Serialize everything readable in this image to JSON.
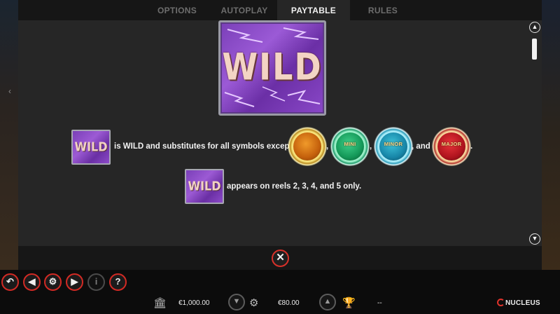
{
  "tabs": [
    {
      "label": "OPTIONS",
      "active": false
    },
    {
      "label": "AUTOPLAY",
      "active": false
    },
    {
      "label": "PAYTABLE",
      "active": true
    },
    {
      "label": "RULES",
      "active": false
    }
  ],
  "paytable": {
    "wild_symbol_text": "WILD",
    "line1_text": "is WILD and substitutes for all symbols except",
    "line1_sep1": ",",
    "line1_sep2": ",",
    "line1_and": ", and",
    "line1_end": ".",
    "line2_text": "appears on reels 2, 3, 4, and 5 only.",
    "jackpots": [
      {
        "name": "gold-jackpot",
        "label": "",
        "color": "#c4600c"
      },
      {
        "name": "mini-jackpot",
        "label": "MINI",
        "color": "#149858"
      },
      {
        "name": "minor-jackpot",
        "label": "MINOR",
        "color": "#1786a8"
      },
      {
        "name": "major-jackpot",
        "label": "MAJOR",
        "color": "#b0141e"
      }
    ]
  },
  "controls": {
    "icons": [
      "back-icon",
      "sound-icon",
      "settings-icon",
      "play-icon",
      "info-icon",
      "help-icon"
    ]
  },
  "info_bar": {
    "balance": "€1,000.00",
    "bet": "€80.00",
    "win": "--",
    "brand": "NUCLEUS"
  },
  "colors": {
    "accent_red": "#d22a24",
    "panel_bg": "#262626",
    "wild_purple": "#7a3fb8"
  }
}
